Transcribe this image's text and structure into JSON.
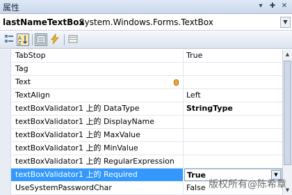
{
  "window": {
    "title": "属性"
  },
  "titlebar_icons": {
    "pin": "▾",
    "dock": "✚",
    "close": "✕"
  },
  "selector": {
    "object_name": "lastNameTextBox",
    "object_type": "System.Windows.Forms.TextBox"
  },
  "toolbar": {
    "categorized_icon": "categorized-icon",
    "alphabetical_icon": "alphabetical-icon",
    "properties_icon": "properties-icon",
    "events_icon": "events-icon",
    "property_pages_icon": "property-pages-icon"
  },
  "properties": [
    {
      "name": "TabStop",
      "value": "True"
    },
    {
      "name": "Tag",
      "value": ""
    },
    {
      "name": "Text",
      "value": ""
    },
    {
      "name": "TextAlign",
      "value": "Left"
    },
    {
      "name": "textBoxValidator1 上的 DataType",
      "value": "StringType"
    },
    {
      "name": "textBoxValidator1 上的 DisplayName",
      "value": ""
    },
    {
      "name": "textBoxValidator1 上的 MaxValue",
      "value": ""
    },
    {
      "name": "textBoxValidator1 上的 MinValue",
      "value": ""
    },
    {
      "name": "textBoxValidator1 上的 RegularExpression",
      "value": ""
    },
    {
      "name": "textBoxValidator1 上的 Required",
      "value": "True"
    },
    {
      "name": "UseSystemPasswordChar",
      "value": "False"
    }
  ],
  "colors": {
    "selection": "#3399ff",
    "gutter": "#e8edf5"
  },
  "watermark": "版权所有@陈希章"
}
